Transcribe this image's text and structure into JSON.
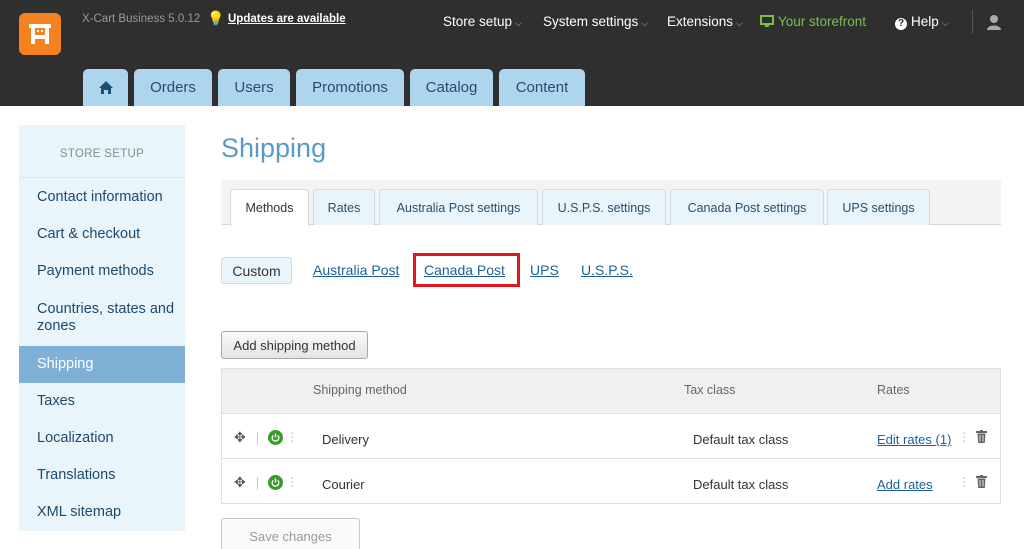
{
  "header": {
    "brand": "X-Cart Business 5.0.12",
    "updates_link": "Updates are available",
    "menu": {
      "store_setup": "Store setup",
      "system_settings": "System settings",
      "extensions": "Extensions",
      "storefront": "Your storefront",
      "help": "Help"
    },
    "tabs": {
      "orders": "Orders",
      "users": "Users",
      "promotions": "Promotions",
      "catalog": "Catalog",
      "content": "Content"
    },
    "colors": {
      "bar": "#2f2f2f",
      "logo": "#f58220",
      "storefront": "#78c04a",
      "tab": "#aed4ee"
    }
  },
  "sidebar": {
    "title": "STORE SETUP",
    "items": [
      {
        "label": "Contact information"
      },
      {
        "label": "Cart & checkout"
      },
      {
        "label": "Payment methods"
      },
      {
        "label": "Countries, states and zones"
      },
      {
        "label": "Shipping"
      },
      {
        "label": "Taxes"
      },
      {
        "label": "Localization"
      },
      {
        "label": "Translations"
      },
      {
        "label": "XML sitemap"
      }
    ]
  },
  "main": {
    "title": "Shipping",
    "tabs": [
      {
        "label": "Methods"
      },
      {
        "label": "Rates"
      },
      {
        "label": "Australia Post settings"
      },
      {
        "label": "U.S.P.S. settings"
      },
      {
        "label": "Canada Post settings"
      },
      {
        "label": "UPS settings"
      }
    ],
    "carriers": {
      "custom": "Custom",
      "australia_post": "Australia Post",
      "canada_post": "Canada Post",
      "ups": "UPS",
      "usps": "U.S.P.S."
    },
    "add_button": "Add shipping method",
    "table": {
      "headers": {
        "method": "Shipping method",
        "tax": "Tax class",
        "rates": "Rates"
      },
      "rows": [
        {
          "method": "Delivery",
          "tax": "Default tax class",
          "rates": "Edit rates (1)"
        },
        {
          "method": "Courier",
          "tax": "Default tax class",
          "rates": "Add rates"
        }
      ]
    },
    "save_button": "Save changes",
    "colors": {
      "accent": "#5a9ac8",
      "active_side": "#7fb0d6",
      "highlight": "#e0171f",
      "enabled": "#3a9a2c"
    }
  }
}
